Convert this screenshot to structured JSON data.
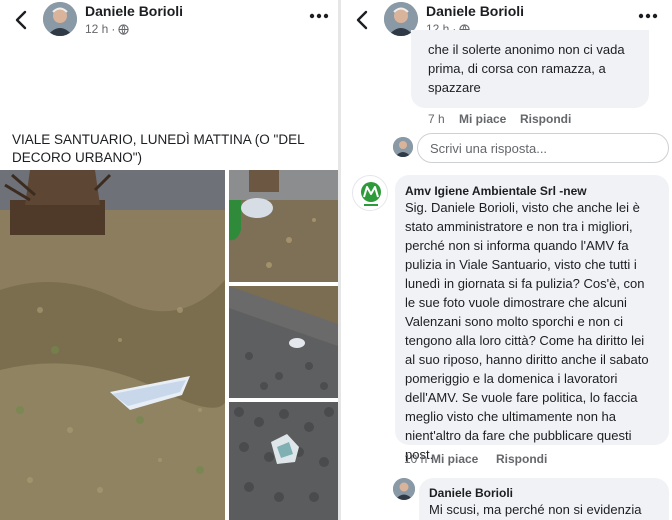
{
  "left": {
    "author": "Daniele Borioli",
    "time": "12 h",
    "post_text": "VIALE SANTUARIO, LUNEDÌ MATTINA (O \"DEL DECORO URBANO\")"
  },
  "right": {
    "author": "Daniele Borioli",
    "time": "12 h",
    "comment_tail": {
      "lines": [
        "che il solerte anonimo non ci vada",
        "prima, di corsa con ramazza, a",
        "spazzare"
      ],
      "time": "7 h",
      "like": "Mi piace",
      "reply": "Rispondi"
    },
    "reply_placeholder": "Scrivi una risposta...",
    "amv_comment": {
      "author": "Amv Igiene Ambientale Srl -new",
      "lines": [
        "Sig. Daniele Borioli, visto che anche lei è",
        "stato amministratore e non tra i migliori,",
        "perché non si informa quando l'AMV fa",
        "pulizia in Viale Santuario, visto che tutti i",
        "lunedì in giornata si fa pulizia? Cos'è, con",
        "le sue foto vuole dimostrare che alcuni",
        "Valenzani sono molto sporchi e non ci",
        "tengono alla loro città? Come ha diritto lei",
        "al suo riposo, hanno diritto anche il sabato",
        "pomeriggio e la domenica i lavoratori",
        "dell'AMV. Se vuole fare politica, lo faccia",
        "meglio visto che ultimamente non ha",
        "nient'altro da fare che pubblicare questi",
        "post."
      ],
      "time": "10 h",
      "like": "Mi piace",
      "reply": "Rispondi"
    },
    "last_comment": {
      "author": "Daniele Borioli",
      "text": "Mi scusi, ma perché non si evidenzia"
    }
  },
  "colors": {
    "amv_green": "#2e9b3a",
    "muted": "#65676b",
    "bubble": "#f0f2f5"
  },
  "icons": [
    "back-arrow-icon",
    "globe-icon",
    "more-icon"
  ]
}
